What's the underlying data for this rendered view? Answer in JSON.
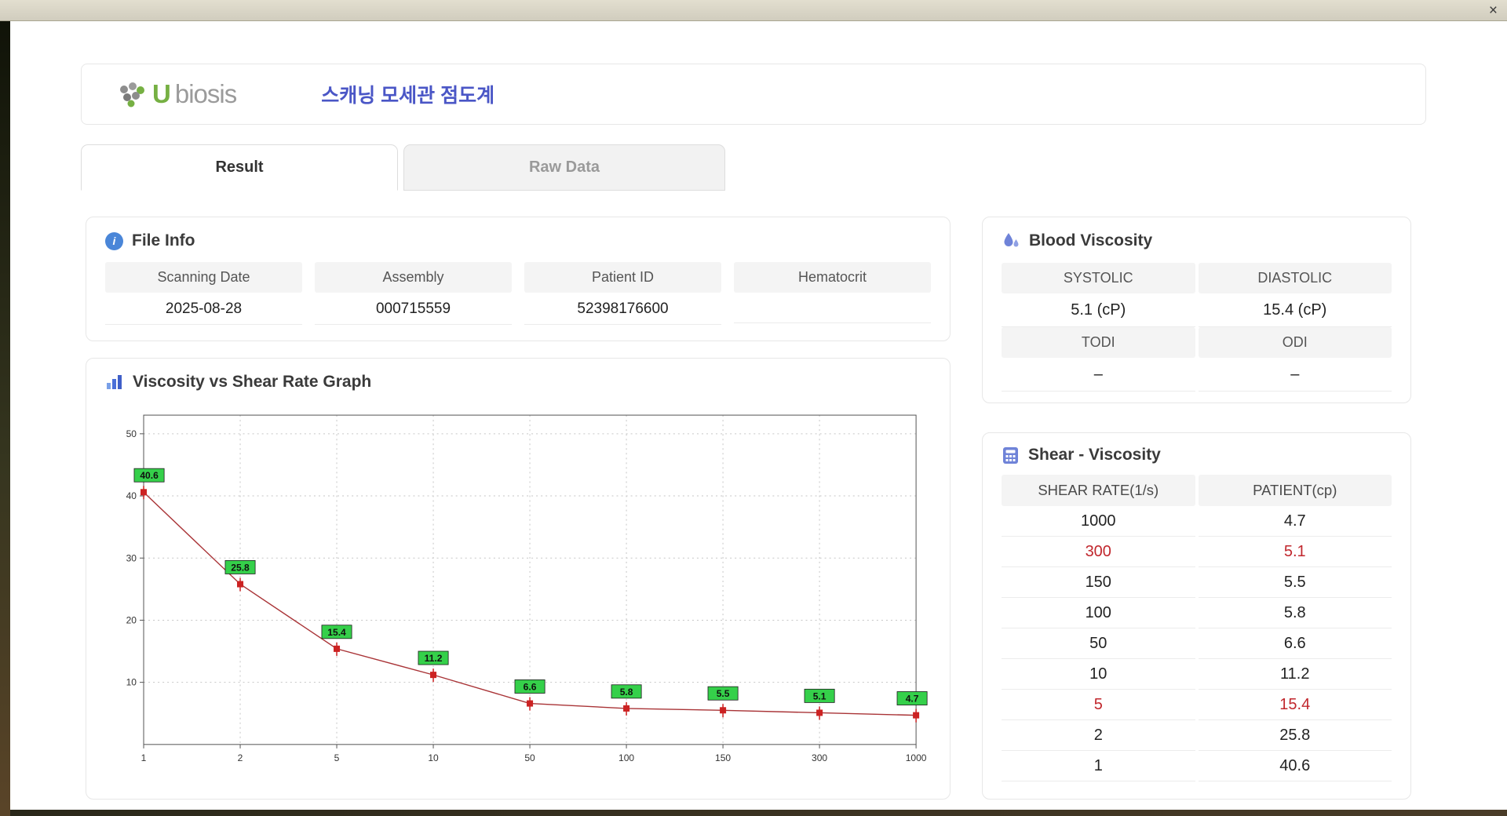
{
  "window": {
    "close_label": "×"
  },
  "header": {
    "logo_text_u": "U",
    "logo_text_rest": "biosis",
    "title": "스캐닝 모세관 점도계"
  },
  "tabs": {
    "result": "Result",
    "raw_data": "Raw Data"
  },
  "file_info": {
    "title": "File Info",
    "fields": [
      {
        "label": "Scanning Date",
        "value": "2025-08-28"
      },
      {
        "label": "Assembly",
        "value": "000715559"
      },
      {
        "label": "Patient ID",
        "value": "52398176600"
      },
      {
        "label": "Hematocrit",
        "value": ""
      }
    ]
  },
  "graph": {
    "title": "Viscosity vs Shear Rate Graph"
  },
  "chart_data": {
    "type": "line",
    "title": "Viscosity vs Shear Rate Graph",
    "xlabel": "",
    "ylabel": "",
    "x_categories": [
      "1",
      "2",
      "5",
      "10",
      "50",
      "100",
      "150",
      "300",
      "1000"
    ],
    "values": [
      40.6,
      25.8,
      15.4,
      11.2,
      6.6,
      5.8,
      5.5,
      5.1,
      4.7
    ],
    "y_ticks": [
      10,
      20,
      30,
      40,
      50
    ],
    "ylim": [
      0,
      53
    ],
    "grid": true,
    "line_color": "#a93437",
    "marker_color": "#cc2222",
    "label_bg": "#35d04a",
    "legend": "none"
  },
  "blood_viscosity": {
    "title": "Blood Viscosity",
    "systolic_label": "SYSTOLIC",
    "diastolic_label": "DIASTOLIC",
    "systolic_value": "5.1 (cP)",
    "diastolic_value": "15.4 (cP)",
    "todi_label": "TODI",
    "odi_label": "ODI",
    "todi_value": "–",
    "odi_value": "–"
  },
  "shear_viscosity": {
    "title": "Shear - Viscosity",
    "columns": [
      "SHEAR RATE(1/s)",
      "PATIENT(cp)"
    ],
    "rows": [
      {
        "rate": "1000",
        "patient": "4.7",
        "highlight": false
      },
      {
        "rate": "300",
        "patient": "5.1",
        "highlight": true
      },
      {
        "rate": "150",
        "patient": "5.5",
        "highlight": false
      },
      {
        "rate": "100",
        "patient": "5.8",
        "highlight": false
      },
      {
        "rate": "50",
        "patient": "6.6",
        "highlight": false
      },
      {
        "rate": "10",
        "patient": "11.2",
        "highlight": false
      },
      {
        "rate": "5",
        "patient": "15.4",
        "highlight": true
      },
      {
        "rate": "2",
        "patient": "25.8",
        "highlight": false
      },
      {
        "rate": "1",
        "patient": "40.6",
        "highlight": false
      }
    ]
  }
}
